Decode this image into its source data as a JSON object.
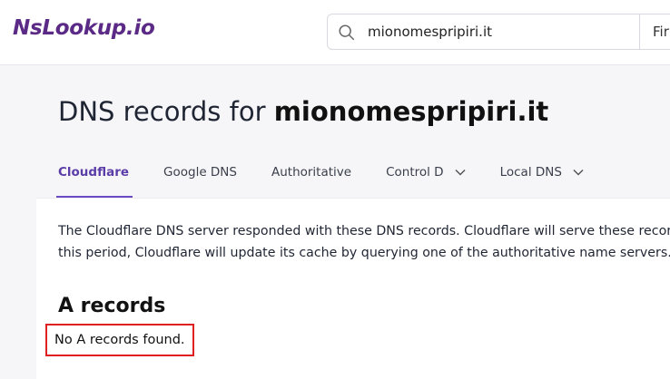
{
  "header": {
    "logo": "NsLookup.io",
    "search": {
      "value": "mionomespripiri.it",
      "button_label": "Fir"
    }
  },
  "page": {
    "title_prefix": "DNS records for ",
    "title_domain": "mionomespripiri.it"
  },
  "tabs": [
    {
      "label": "Cloudflare",
      "active": true
    },
    {
      "label": "Google DNS",
      "active": false
    },
    {
      "label": "Authoritative",
      "active": false
    },
    {
      "label": "Control D",
      "active": false,
      "dropdown": true
    },
    {
      "label": "Local DNS",
      "active": false,
      "dropdown": true
    }
  ],
  "content": {
    "description_line1": "The Cloudflare DNS server responded with these DNS records. Cloudflare will serve these record",
    "description_line2": "this period, Cloudflare will update its cache by querying one of the authoritative name servers.",
    "section_title": "A records",
    "empty_message": "No A records found."
  },
  "colors": {
    "brand": "#5b2a86",
    "active_tab": "#5b3da8",
    "highlight_border": "#e02020"
  }
}
